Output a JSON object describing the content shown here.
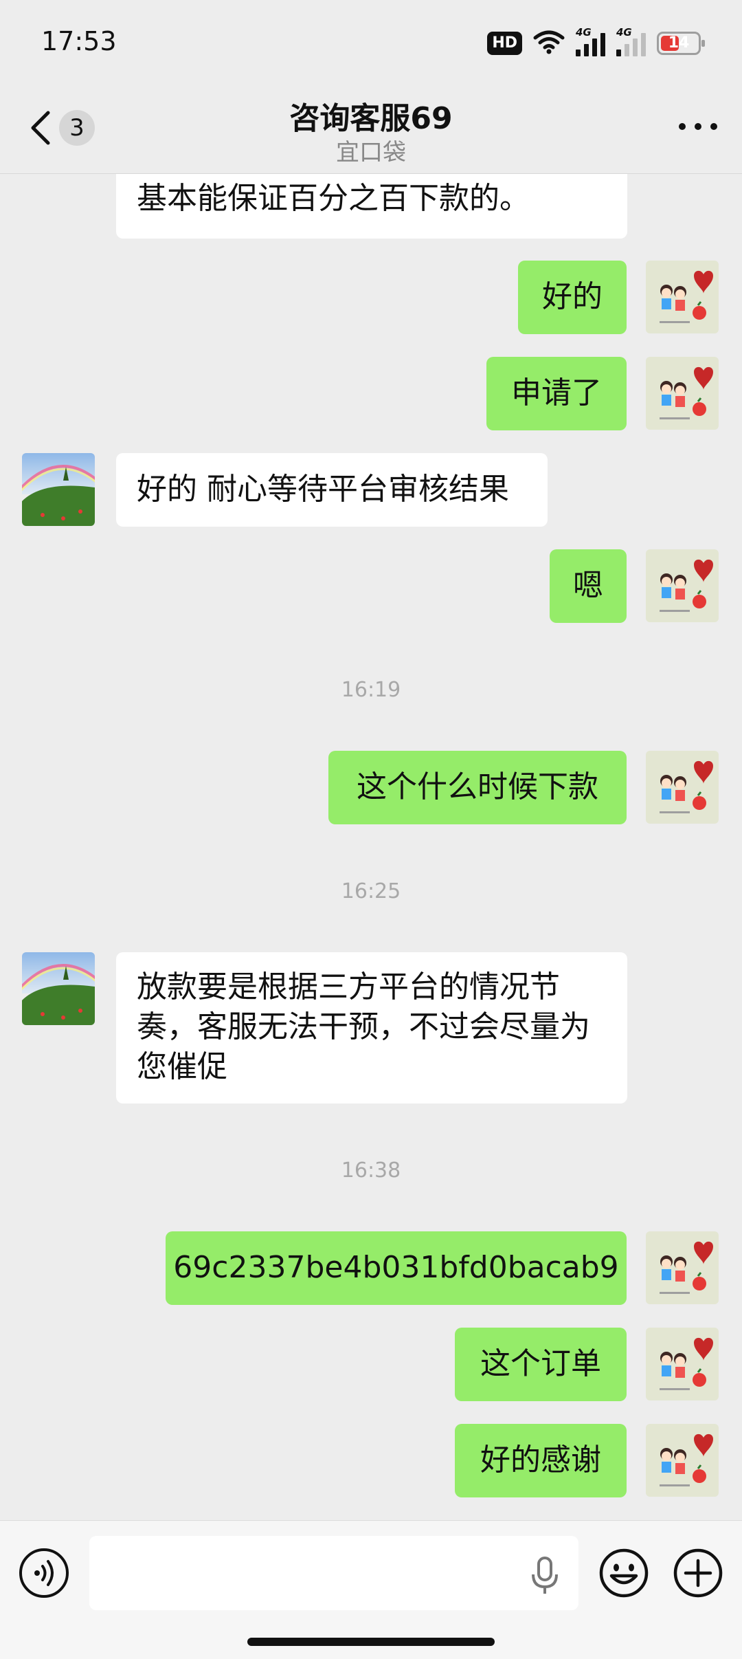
{
  "status_bar": {
    "time": "17:53",
    "hd_label": "HD",
    "network1_label": "4G",
    "network2_label": "4G",
    "battery_level": "14",
    "icons": [
      "hd-icon",
      "wifi-icon",
      "signal-icon",
      "signal-icon",
      "battery-icon"
    ]
  },
  "header": {
    "back_icon": "chevron-left-icon",
    "unread_count": "3",
    "title": "咨询客服69",
    "subtitle": "宜口袋",
    "more_icon": "more-horizontal-icon"
  },
  "colors": {
    "background": "#ededed",
    "outgoing_bubble": "#95ec69",
    "incoming_bubble": "#ffffff",
    "timestamp_text": "#a8a8a8"
  },
  "messages": [
    {
      "direction": "in",
      "text": "基本能保证百分之百下款的。",
      "partial": true
    },
    {
      "direction": "out",
      "text": "好的"
    },
    {
      "direction": "out",
      "text": "申请了"
    },
    {
      "direction": "in",
      "text": "好的 耐心等待平台审核结果"
    },
    {
      "direction": "out",
      "text": "嗯"
    },
    {
      "type": "time",
      "text": "16:19"
    },
    {
      "direction": "out",
      "text": "这个什么时候下款"
    },
    {
      "type": "time",
      "text": "16:25"
    },
    {
      "direction": "in",
      "text": "放款要是根据三方平台的情况节\n奏，客服无法干预，不过会尽量为\n您催促"
    },
    {
      "type": "time",
      "text": "16:38"
    },
    {
      "direction": "out",
      "text": "69c2337be4b031bfd0bacab9"
    },
    {
      "direction": "out",
      "text": "这个订单"
    },
    {
      "direction": "out",
      "text": "好的感谢"
    }
  ],
  "input_bar": {
    "voice_icon": "voice-icon",
    "text_value": "",
    "mic_icon": "microphone-icon",
    "emoji_icon": "emoji-icon",
    "plus_icon": "plus-icon"
  }
}
